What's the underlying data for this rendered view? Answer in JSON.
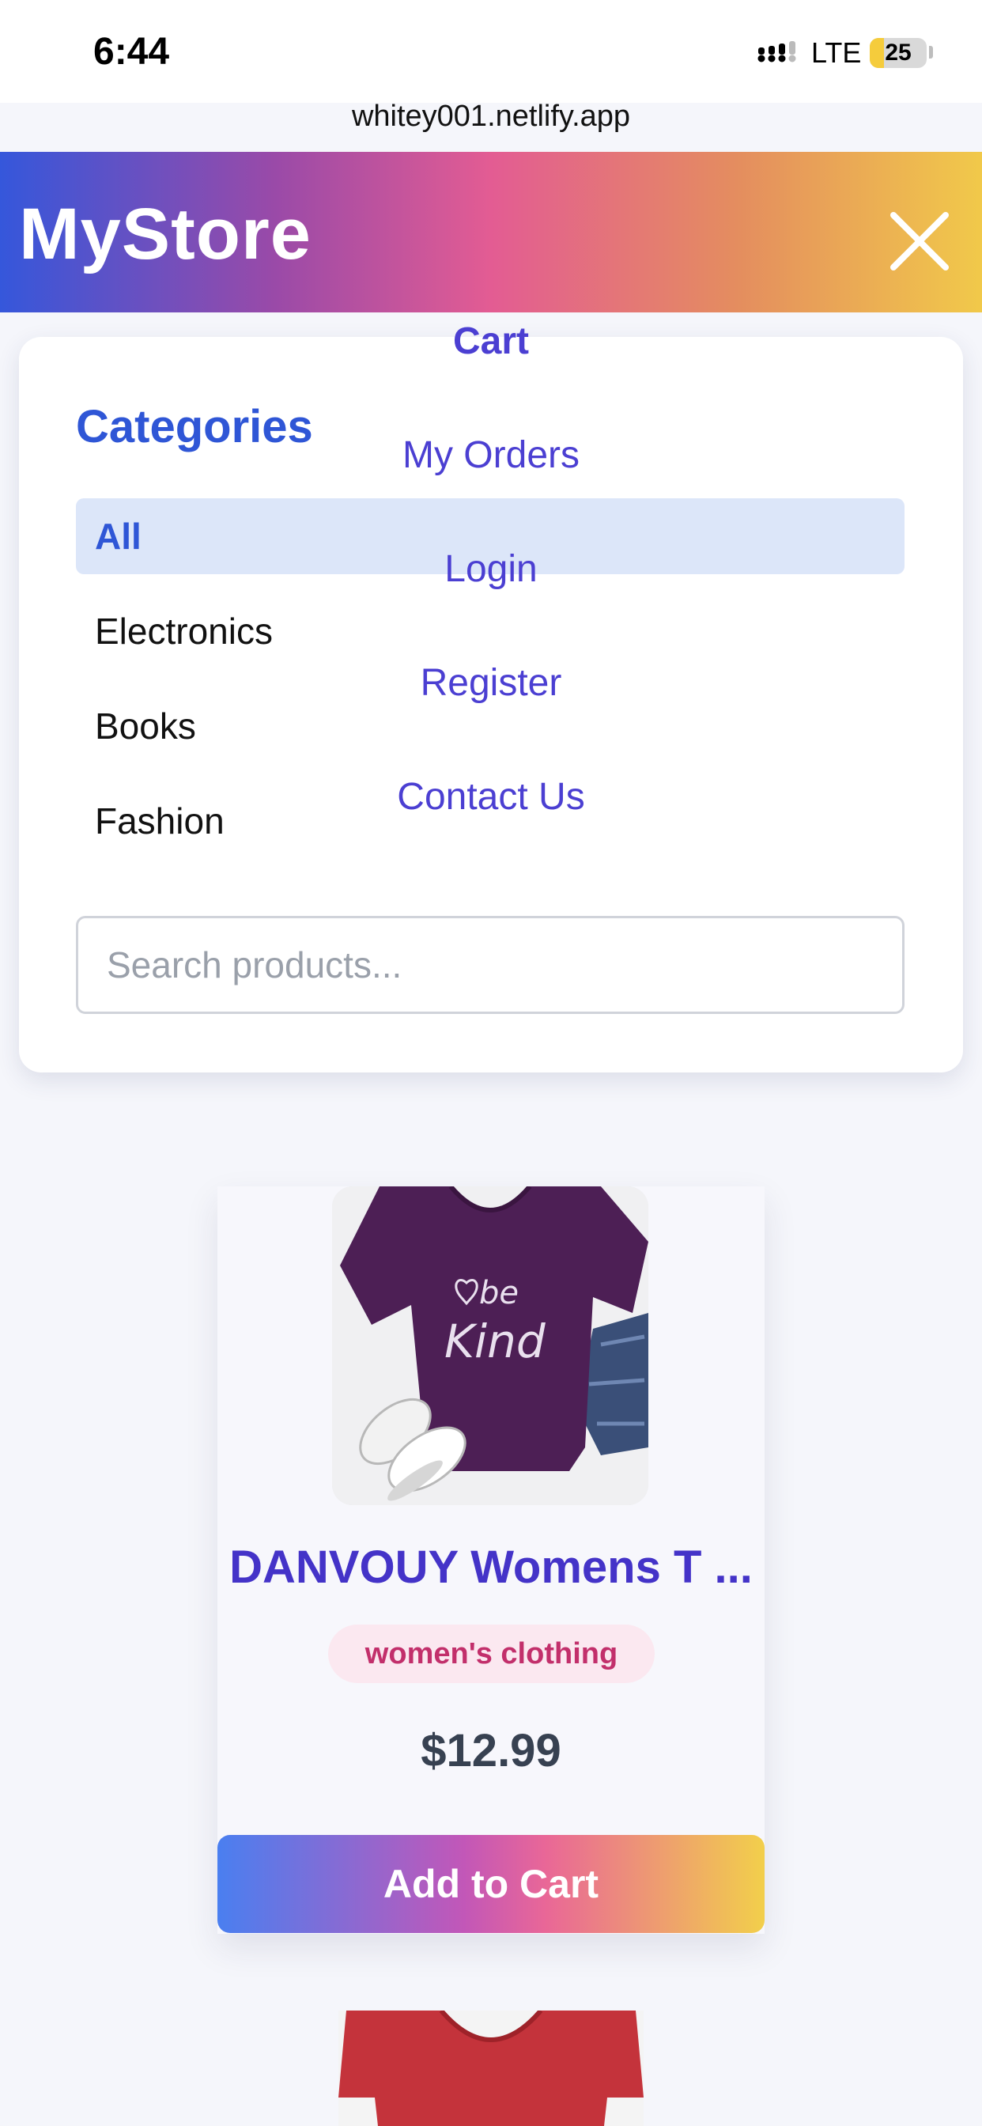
{
  "status_bar": {
    "time": "6:44",
    "network": "LTE",
    "battery_level": "25",
    "battery_fraction": 0.25,
    "url": "whitey001.netlify.app"
  },
  "header": {
    "brand": "MyStore",
    "close_icon": "close-icon",
    "gradient": [
      "#3557db",
      "#e35c93",
      "#f1c94a"
    ]
  },
  "nav": {
    "links": [
      "Cart",
      "My Orders",
      "Login",
      "Register",
      "Contact Us"
    ],
    "color": "#4b3fd2"
  },
  "categories": {
    "title": "Categories",
    "items": [
      "All",
      "Electronics",
      "Books",
      "Fashion"
    ],
    "selected": "All"
  },
  "search": {
    "placeholder": "Search products...",
    "value": ""
  },
  "product": {
    "title": "DANVOUY Womens T ...",
    "category": "women's clothing",
    "price": "$12.99",
    "image_caption": "be Kind",
    "add_button": "Add to Cart"
  }
}
